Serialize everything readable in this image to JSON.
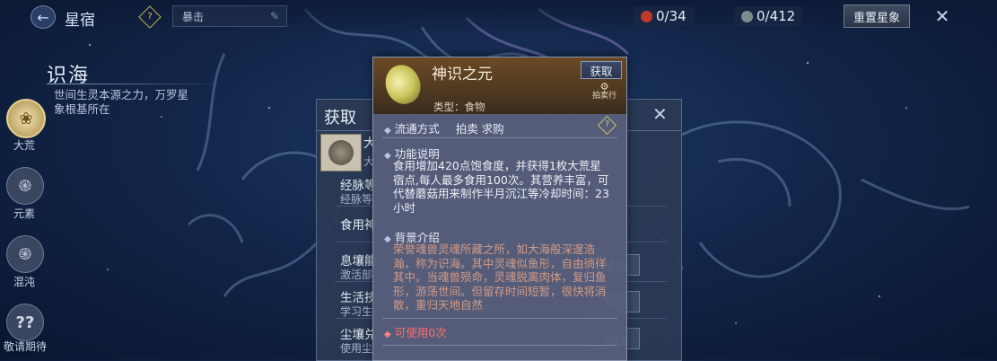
{
  "topbar": {
    "back_icon": "circle-arrow-left-icon",
    "title": "星宿",
    "search_placeholder": "暴击",
    "counter_red": "0/34",
    "counter_gray": "0/412",
    "reset_label": "重置星象",
    "close_icon": "close-icon",
    "colors": {
      "red_dot": "#c0392b",
      "gray_dot": "#7f8c8d"
    }
  },
  "sidebar": {
    "category": "识海",
    "description": "世间生灵本源之力，万罗星象根基所在",
    "items": [
      {
        "label": "大荒",
        "icon": "dahuang-emblem-icon"
      },
      {
        "label": "元素",
        "icon": "spiral-icon"
      },
      {
        "label": "混沌",
        "icon": "vortex-icon"
      },
      {
        "label": "敬请期待",
        "icon": "question-marks-icon"
      }
    ]
  },
  "acquire_panel": {
    "title": "获取",
    "item_name": "大",
    "item_sub": "大",
    "rows": [
      {
        "label": "经脉等",
        "sub": "经脉等",
        "go": ""
      },
      {
        "label": "食用神",
        "sub": "",
        "go": ""
      },
      {
        "label": "息壤能",
        "sub": "激活部",
        "go": "前往"
      },
      {
        "label": "生活技",
        "sub": "学习生",
        "go": "前往"
      },
      {
        "label": "尘壤兑",
        "sub": "使用尘",
        "go": "前往"
      }
    ]
  },
  "tooltip": {
    "name": "神识之元",
    "obtain_button": "获取",
    "auction_label": "拍卖行",
    "type": "类型：食物",
    "circulation_label": "流通方式",
    "circulation_value": "拍卖 求购",
    "function_title": "功能说明",
    "function_text": "食用增加420点饱食度，并获得1枚大荒星宿点,每人最多食用100次。其营养丰富，可代替蘑菇用来制作半月沉江等冷却时间：23小时",
    "background_title": "背景介绍",
    "background_text": "荣誉魂兽灵魂所藏之所，如大海般深邃浩瀚，称为识海。其中灵魂似鱼形，自由徜徉其中。当魂兽殒命，灵魂脱离肉体，复归鱼形，游荡世间。但留存时间短暂，很快将消散，重归天地自然",
    "usable": "可使用0次",
    "colors": {
      "bg_text": "#d29b86",
      "usable": "#ff6e6e"
    }
  }
}
